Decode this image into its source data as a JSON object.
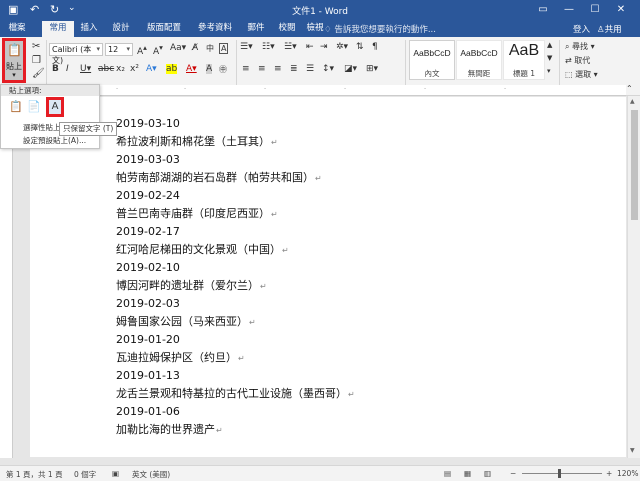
{
  "window": {
    "title": "文件1 - Word",
    "login": "登入",
    "share": "共用"
  },
  "tabs": [
    "檔案",
    "常用",
    "插入",
    "設計",
    "版面配置",
    "參考資料",
    "郵件",
    "校閱",
    "檢視"
  ],
  "tell_me": "告訴我您想要執行的動作...",
  "ribbon": {
    "paste_label": "貼上",
    "font_name": "Calibri (本文)",
    "font_size": "12",
    "font_group_label": "字型",
    "paragraph_group_label": "段落",
    "styles_group_label": "樣式",
    "edit_group_label": "編輯",
    "styles": [
      {
        "sample": "AaBbCcD",
        "name": "內文"
      },
      {
        "sample": "AaBbCcD",
        "name": "無間距"
      },
      {
        "sample": "AaB",
        "name": "標題 1"
      }
    ],
    "find": "尋找",
    "replace": "取代",
    "select": "選取"
  },
  "paste_dropdown": {
    "header": "貼上選項:",
    "menu_item_1": "選擇性貼上(S)...",
    "menu_item_2": "設定預設貼上(A)...",
    "tooltip": "只保留文字 (T)"
  },
  "document": {
    "lines": [
      "2019-03-10",
      "希拉波利斯和棉花堡（土耳其）",
      "2019-03-03",
      "帕劳南部湖湖的岩石岛群（帕劳共和国）",
      "2019-02-24",
      "普兰巴南寺庙群（印度尼西亚）",
      "2019-02-17",
      "红河哈尼梯田的文化景观（中国）",
      "2019-02-10",
      "博因河畔的遗址群（爱尔兰）",
      "2019-02-03",
      "姆鲁国家公园（马来西亚）",
      "2019-01-20",
      "瓦迪拉姆保护区（约旦）",
      "2019-01-13",
      "龙舌兰景观和特基拉的古代工业设施（墨西哥）",
      "2019-01-06",
      "加勒比海的世界遗产"
    ]
  },
  "statusbar": {
    "page": "第 1 頁，共 1 頁",
    "words": "0 個字",
    "language": "英文 (美國)",
    "zoom": "120%"
  }
}
